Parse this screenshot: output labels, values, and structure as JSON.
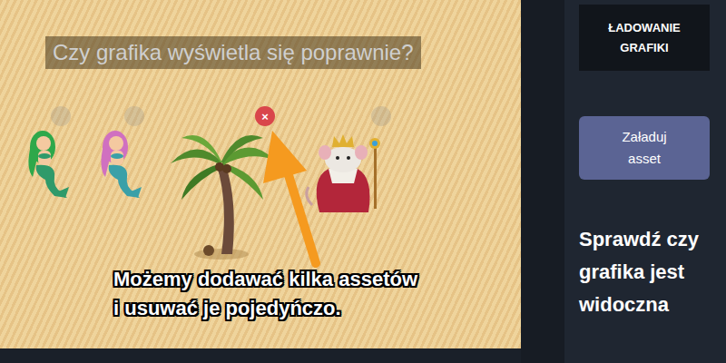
{
  "canvas": {
    "title": "Czy grafika wyświetla się poprawnie?",
    "caption": [
      "Możemy dodawać kilka assetów",
      "i usuwać je pojedyńczo."
    ],
    "remove_icon": "×",
    "assets": [
      {
        "kind": "mermaid-green",
        "highlighted": false
      },
      {
        "kind": "mermaid-pink",
        "highlighted": false
      },
      {
        "kind": "palm",
        "highlighted": true
      },
      {
        "kind": "king",
        "highlighted": false
      }
    ]
  },
  "sidebar": {
    "panel_title": "ŁADOWANIE GRAFIKI",
    "load_button": "Załaduj asset",
    "hint": "Sprawdź czy grafika jest widoczna"
  }
}
